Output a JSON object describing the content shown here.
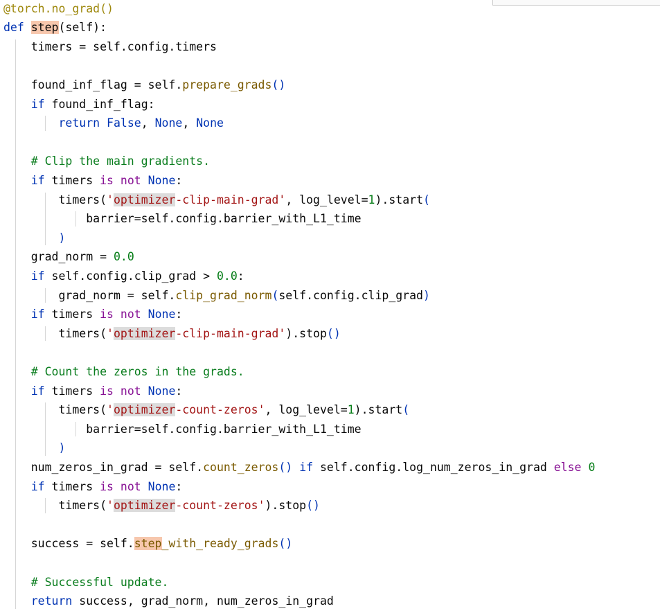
{
  "code": {
    "lines": [
      [
        {
          "t": "@torch.no_grad()",
          "c": "t-deco"
        }
      ],
      [
        {
          "t": "def ",
          "c": "t-kw"
        },
        {
          "t": "step",
          "c": "t-default",
          "h": "hl-orange"
        },
        {
          "t": "(self):",
          "c": "t-default"
        }
      ],
      [
        {
          "t": "    timers = self.config.timers",
          "c": "t-default"
        }
      ],
      [],
      [
        {
          "t": "    found_inf_flag = self.",
          "c": "t-default"
        },
        {
          "t": "prepare_grads",
          "c": "t-call"
        },
        {
          "t": "()",
          "c": "t-paren-blue"
        }
      ],
      [
        {
          "t": "    ",
          "c": "t-default"
        },
        {
          "t": "if",
          "c": "t-kw"
        },
        {
          "t": " found_inf_flag:",
          "c": "t-default"
        }
      ],
      [
        {
          "t": "        ",
          "c": "t-default"
        },
        {
          "t": "return False",
          "c": "t-kw"
        },
        {
          "t": ", ",
          "c": "t-default"
        },
        {
          "t": "None",
          "c": "t-kw"
        },
        {
          "t": ", ",
          "c": "t-default"
        },
        {
          "t": "None",
          "c": "t-kw"
        }
      ],
      [],
      [
        {
          "t": "    # Clip the main gradients.",
          "c": "t-com"
        }
      ],
      [
        {
          "t": "    ",
          "c": "t-default"
        },
        {
          "t": "if",
          "c": "t-kw"
        },
        {
          "t": " timers ",
          "c": "t-default"
        },
        {
          "t": "is not",
          "c": "t-kw2"
        },
        {
          "t": " ",
          "c": "t-default"
        },
        {
          "t": "None",
          "c": "t-kw"
        },
        {
          "t": ":",
          "c": "t-default"
        }
      ],
      [
        {
          "t": "        timers(",
          "c": "t-default"
        },
        {
          "t": "'",
          "c": "t-strred"
        },
        {
          "t": "optimizer",
          "c": "t-strred",
          "h": "hl-gray"
        },
        {
          "t": "-clip-main-grad'",
          "c": "t-strred"
        },
        {
          "t": ", log_level=",
          "c": "t-default"
        },
        {
          "t": "1",
          "c": "t-num-g"
        },
        {
          "t": ").start",
          "c": "t-default"
        },
        {
          "t": "(",
          "c": "t-paren-blue"
        }
      ],
      [
        {
          "t": "            barrier=self.config.barrier_with_L1_time",
          "c": "t-default"
        }
      ],
      [
        {
          "t": "        ",
          "c": "t-default"
        },
        {
          "t": ")",
          "c": "t-paren-blue"
        }
      ],
      [
        {
          "t": "    grad_norm = ",
          "c": "t-default"
        },
        {
          "t": "0.0",
          "c": "t-num-g"
        }
      ],
      [
        {
          "t": "    ",
          "c": "t-default"
        },
        {
          "t": "if",
          "c": "t-kw"
        },
        {
          "t": " self.config.clip_grad > ",
          "c": "t-default"
        },
        {
          "t": "0.0",
          "c": "t-num-g"
        },
        {
          "t": ":",
          "c": "t-default"
        }
      ],
      [
        {
          "t": "        grad_norm = self.",
          "c": "t-default"
        },
        {
          "t": "clip_grad_norm",
          "c": "t-call"
        },
        {
          "t": "(",
          "c": "t-paren-blue"
        },
        {
          "t": "self.config.clip_grad",
          "c": "t-default"
        },
        {
          "t": ")",
          "c": "t-paren-blue"
        }
      ],
      [
        {
          "t": "    ",
          "c": "t-default"
        },
        {
          "t": "if",
          "c": "t-kw"
        },
        {
          "t": " timers ",
          "c": "t-default"
        },
        {
          "t": "is not",
          "c": "t-kw2"
        },
        {
          "t": " ",
          "c": "t-default"
        },
        {
          "t": "None",
          "c": "t-kw"
        },
        {
          "t": ":",
          "c": "t-default"
        }
      ],
      [
        {
          "t": "        timers(",
          "c": "t-default"
        },
        {
          "t": "'",
          "c": "t-strred"
        },
        {
          "t": "optimizer",
          "c": "t-strred",
          "h": "hl-gray"
        },
        {
          "t": "-clip-main-grad'",
          "c": "t-strred"
        },
        {
          "t": ").stop",
          "c": "t-default"
        },
        {
          "t": "()",
          "c": "t-paren-blue"
        }
      ],
      [],
      [
        {
          "t": "    # Count the zeros in the grads.",
          "c": "t-com"
        }
      ],
      [
        {
          "t": "    ",
          "c": "t-default"
        },
        {
          "t": "if",
          "c": "t-kw"
        },
        {
          "t": " timers ",
          "c": "t-default"
        },
        {
          "t": "is not",
          "c": "t-kw2"
        },
        {
          "t": " ",
          "c": "t-default"
        },
        {
          "t": "None",
          "c": "t-kw"
        },
        {
          "t": ":",
          "c": "t-default"
        }
      ],
      [
        {
          "t": "        timers(",
          "c": "t-default"
        },
        {
          "t": "'",
          "c": "t-strred"
        },
        {
          "t": "optimizer",
          "c": "t-strred",
          "h": "hl-gray"
        },
        {
          "t": "-count-zeros'",
          "c": "t-strred"
        },
        {
          "t": ", log_level=",
          "c": "t-default"
        },
        {
          "t": "1",
          "c": "t-num-g"
        },
        {
          "t": ").start",
          "c": "t-default"
        },
        {
          "t": "(",
          "c": "t-paren-blue"
        }
      ],
      [
        {
          "t": "            barrier=self.config.barrier_with_L1_time",
          "c": "t-default"
        }
      ],
      [
        {
          "t": "        ",
          "c": "t-default"
        },
        {
          "t": ")",
          "c": "t-paren-blue"
        }
      ],
      [
        {
          "t": "    num_zeros_in_grad = self.",
          "c": "t-default"
        },
        {
          "t": "count_zeros",
          "c": "t-call"
        },
        {
          "t": "()",
          "c": "t-paren-blue"
        },
        {
          "t": " ",
          "c": "t-default"
        },
        {
          "t": "if",
          "c": "t-kw"
        },
        {
          "t": " self.config.log_num_zeros_in_grad ",
          "c": "t-default"
        },
        {
          "t": "else",
          "c": "t-kw2"
        },
        {
          "t": " ",
          "c": "t-default"
        },
        {
          "t": "0",
          "c": "t-num-g"
        }
      ],
      [
        {
          "t": "    ",
          "c": "t-default"
        },
        {
          "t": "if",
          "c": "t-kw"
        },
        {
          "t": " timers ",
          "c": "t-default"
        },
        {
          "t": "is not",
          "c": "t-kw2"
        },
        {
          "t": " ",
          "c": "t-default"
        },
        {
          "t": "None",
          "c": "t-kw"
        },
        {
          "t": ":",
          "c": "t-default"
        }
      ],
      [
        {
          "t": "        timers(",
          "c": "t-default"
        },
        {
          "t": "'",
          "c": "t-strred"
        },
        {
          "t": "optimizer",
          "c": "t-strred",
          "h": "hl-gray"
        },
        {
          "t": "-count-zeros'",
          "c": "t-strred"
        },
        {
          "t": ").stop",
          "c": "t-default"
        },
        {
          "t": "()",
          "c": "t-paren-blue"
        }
      ],
      [],
      [
        {
          "t": "    success = self.",
          "c": "t-default"
        },
        {
          "t": "step",
          "c": "t-call",
          "h": "hl-orange"
        },
        {
          "t": "_with_ready_grads",
          "c": "t-call"
        },
        {
          "t": "()",
          "c": "t-paren-blue"
        }
      ],
      [],
      [
        {
          "t": "    # Successful update.",
          "c": "t-com"
        }
      ],
      [
        {
          "t": "    ",
          "c": "t-default"
        },
        {
          "t": "return",
          "c": "t-kw"
        },
        {
          "t": " success, grad_norm, num_zeros_in_grad",
          "c": "t-default"
        }
      ]
    ]
  }
}
